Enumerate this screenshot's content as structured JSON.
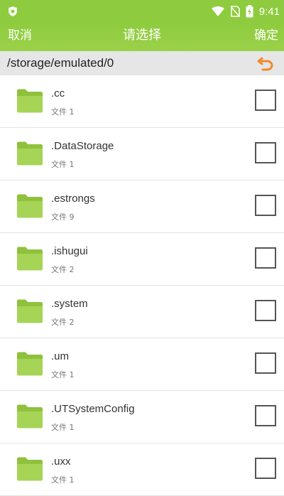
{
  "status_bar": {
    "time": "9:41"
  },
  "header": {
    "cancel_label": "取消",
    "title": "请选择",
    "confirm_label": "确定"
  },
  "path": {
    "current": "/storage/emulated/0"
  },
  "items": [
    {
      "name": ".cc",
      "meta": "文件 1"
    },
    {
      "name": ".DataStorage",
      "meta": "文件 1"
    },
    {
      "name": ".estrongs",
      "meta": "文件 9"
    },
    {
      "name": ".ishugui",
      "meta": "文件 2"
    },
    {
      "name": ".system",
      "meta": "文件 2"
    },
    {
      "name": ".um",
      "meta": "文件 1"
    },
    {
      "name": ".UTSystemConfig",
      "meta": "文件 1"
    },
    {
      "name": ".uxx",
      "meta": "文件 1"
    }
  ],
  "colors": {
    "accent": "#8ecb3e",
    "folder": "#9ccc4a",
    "back_arrow": "#f08a2b"
  },
  "icons": {
    "folder": "folder-icon",
    "back": "back-arrow-icon",
    "checkbox": "checkbox-unchecked"
  }
}
